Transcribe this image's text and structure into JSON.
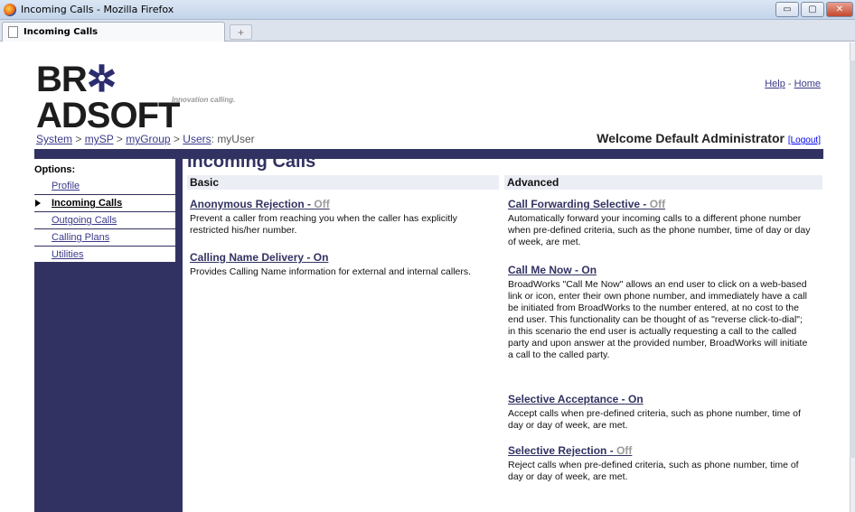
{
  "window": {
    "title": "Incoming Calls - Mozilla Firefox",
    "tab_label": "Incoming Calls",
    "new_tab": "+",
    "btn_min": "▭",
    "btn_max": "▢",
    "btn_close": "✕"
  },
  "logo": {
    "text_pre": "BR",
    "star": "✲",
    "text_post": "ADSOFT",
    "tagline": "Innovation calling."
  },
  "toplinks": {
    "help": "Help",
    "sep": "-",
    "home": "Home"
  },
  "breadcrumb": {
    "system": "System",
    "sep": ">",
    "sp": "mySP",
    "group": "myGroup",
    "users": "Users",
    "colon": ":",
    "user": "myUser"
  },
  "welcome": {
    "text": "Welcome Default Administrator",
    "logout": "[Logout]"
  },
  "sidebar": {
    "title": "Options:",
    "items": [
      {
        "label": "Profile"
      },
      {
        "label": "Incoming Calls"
      },
      {
        "label": "Outgoing Calls"
      },
      {
        "label": "Calling Plans"
      },
      {
        "label": "Utilities"
      }
    ]
  },
  "main": {
    "title": "Incoming Calls",
    "basic_heading": "Basic",
    "advanced_heading": "Advanced",
    "dash": "-",
    "basic": [
      {
        "name": "Anonymous Rejection",
        "status": "Off",
        "desc": "Prevent a caller from reaching you when the caller has explicitly restricted his/her number."
      },
      {
        "name": "Calling Name Delivery",
        "status": "On",
        "desc": "Provides Calling Name information for external and internal callers."
      }
    ],
    "advanced": [
      {
        "name": "Call Forwarding Selective",
        "status": "Off",
        "desc": "Automatically forward your incoming calls to a different phone number when pre-defined criteria, such as the phone number, time of day or day of week, are met."
      },
      {
        "name": "Call Me Now",
        "status": "On",
        "desc": "BroadWorks \"Call Me Now\" allows an end user to click on a web-based link or icon, enter their own phone number, and immediately have a call be initiated from BroadWorks to the number entered, at no cost to the end user. This functionality can be thought of as \"reverse click-to-dial\"; in this scenario the end user is actually requesting a call to the called party and upon answer at the provided number, BroadWorks will initiate a call to the called party."
      },
      {
        "name": "Selective Acceptance",
        "status": "On",
        "desc": "Accept calls when pre-defined criteria, such as phone number, time of day or day of week, are met."
      },
      {
        "name": "Selective Rejection",
        "status": "Off",
        "desc": "Reject calls when pre-defined criteria, such as phone number, time of day or day of week, are met."
      }
    ]
  },
  "colors": {
    "navy": "#323262",
    "off_gray": "#9a9a9a"
  }
}
